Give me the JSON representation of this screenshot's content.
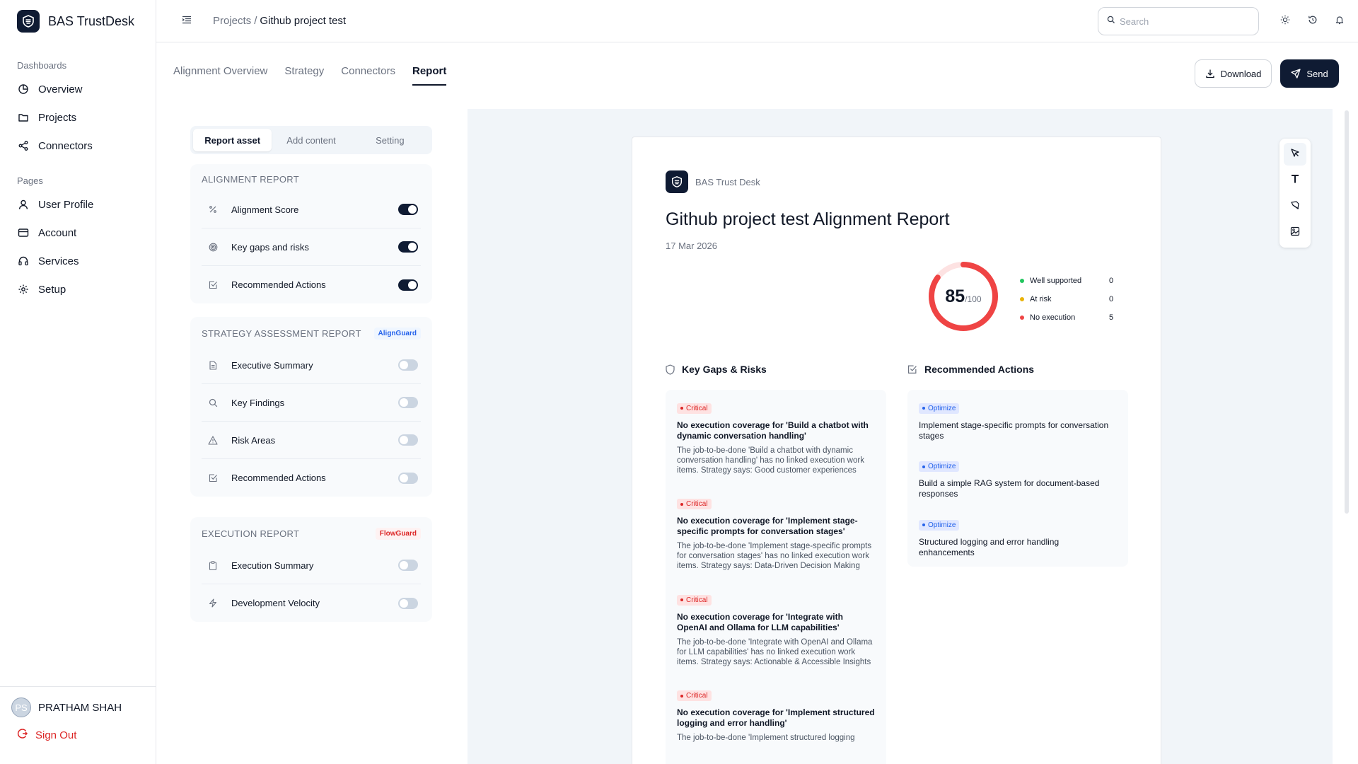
{
  "app": {
    "name": "BAS TrustDesk"
  },
  "sidebar": {
    "sections": [
      {
        "title": "Dashboards",
        "items": [
          {
            "label": "Overview"
          },
          {
            "label": "Projects"
          },
          {
            "label": "Connectors"
          }
        ]
      },
      {
        "title": "Pages",
        "items": [
          {
            "label": "User Profile"
          },
          {
            "label": "Account"
          },
          {
            "label": "Services"
          },
          {
            "label": "Setup"
          }
        ]
      }
    ],
    "user": {
      "initials": "PS",
      "name": "PRATHAM SHAH"
    },
    "signout_label": "Sign Out"
  },
  "header": {
    "breadcrumb": {
      "parent": "Projects",
      "separator": "/",
      "current": "Github project test"
    },
    "search": {
      "placeholder": "Search",
      "value": ""
    }
  },
  "tabs": [
    {
      "label": "Alignment Overview",
      "active": false
    },
    {
      "label": "Strategy",
      "active": false
    },
    {
      "label": "Connectors",
      "active": false
    },
    {
      "label": "Report",
      "active": true
    }
  ],
  "actions": {
    "download_label": "Download",
    "send_label": "Send"
  },
  "panel": {
    "segments": [
      {
        "label": "Report asset",
        "active": true
      },
      {
        "label": "Add content",
        "active": false
      },
      {
        "label": "Setting",
        "active": false
      }
    ],
    "groups": [
      {
        "title": "ALIGNMENT REPORT",
        "badge": "",
        "items": [
          {
            "label": "Alignment Score",
            "icon": "percent-icon",
            "on": true
          },
          {
            "label": "Key gaps and risks",
            "icon": "target-icon",
            "on": true
          },
          {
            "label": "Recommended Actions",
            "icon": "checkbox-icon",
            "on": true
          }
        ]
      },
      {
        "title": "STRATEGY ASSESSMENT REPORT",
        "badge": "AlignGuard",
        "items": [
          {
            "label": "Executive Summary",
            "icon": "document-icon",
            "on": false
          },
          {
            "label": "Key Findings",
            "icon": "search-icon",
            "on": false
          },
          {
            "label": "Risk Areas",
            "icon": "warning-icon",
            "on": false
          },
          {
            "label": "Recommended Actions",
            "icon": "checkbox-icon",
            "on": false
          }
        ]
      },
      {
        "title": "EXECUTION REPORT",
        "badge": "FlowGuard",
        "items": [
          {
            "label": "Execution Summary",
            "icon": "clipboard-icon",
            "on": false
          },
          {
            "label": "Development Velocity",
            "icon": "lightning-icon",
            "on": false
          }
        ]
      }
    ]
  },
  "report": {
    "brand": "BAS Trust Desk",
    "title": "Github project test Alignment Report",
    "date": "17 Mar 2026",
    "score": {
      "value": "85",
      "max": "/100",
      "fraction": 0.85
    },
    "legend": [
      {
        "label": "Well supported",
        "value": "0",
        "color": "#22c55e"
      },
      {
        "label": "At risk",
        "value": "0",
        "color": "#eab308"
      },
      {
        "label": "No execution",
        "value": "5",
        "color": "#ef4444"
      }
    ],
    "gaps_heading": "Key Gaps & Risks",
    "actions_heading": "Recommended Actions",
    "gaps": [
      {
        "badge": "Critical",
        "title": "No execution coverage for 'Build a chatbot with dynamic conversation handling'",
        "desc": "The job-to-be-done 'Build a chatbot with dynamic conversation handling' has no linked execution work items. Strategy says: Good customer experiences"
      },
      {
        "badge": "Critical",
        "title": "No execution coverage for 'Implement stage-specific prompts for conversation stages'",
        "desc": "The job-to-be-done 'Implement stage-specific prompts for conversation stages' has no linked execution work items. Strategy says: Data-Driven Decision Making"
      },
      {
        "badge": "Critical",
        "title": "No execution coverage for 'Integrate with OpenAI and Ollama for LLM capabilities'",
        "desc": "The job-to-be-done 'Integrate with OpenAI and Ollama for LLM capabilities' has no linked execution work items. Strategy says: Actionable & Accessible Insights"
      },
      {
        "badge": "Critical",
        "title": "No execution coverage for 'Implement structured logging and error handling'",
        "desc": "The job-to-be-done 'Implement structured logging"
      }
    ],
    "actions": [
      {
        "badge": "Optimize",
        "title": "Implement stage-specific prompts for conversation stages"
      },
      {
        "badge": "Optimize",
        "title": "Build a simple RAG system for document-based responses"
      },
      {
        "badge": "Optimize",
        "title": "Structured logging and error handling enhancements"
      }
    ]
  }
}
